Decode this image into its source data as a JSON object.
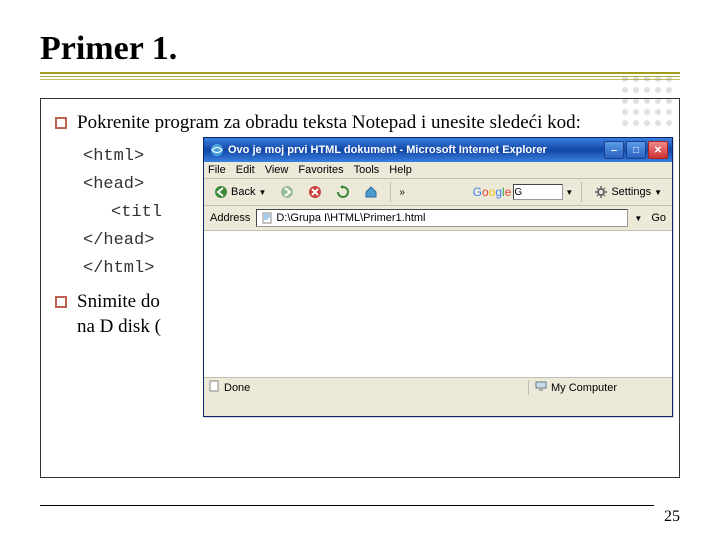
{
  "heading": "Primer 1.",
  "bullets": {
    "b1": "Pokrenite program za obradu teksta Notepad i unesite sledeći kod:",
    "b2": "Snimite do",
    "b2b": "na D disk ("
  },
  "code": {
    "l1": "<html>",
    "l2": "<head>",
    "l3": "<titl",
    "l4": "</head>",
    "l5": "</html>"
  },
  "ie": {
    "title": "Ovo je moj prvi HTML dokument - Microsoft Internet Explorer",
    "menu": {
      "file": "File",
      "edit": "Edit",
      "view": "View",
      "favorites": "Favorites",
      "tools": "Tools",
      "help": "Help"
    },
    "toolbar": {
      "back": "Back",
      "settings": "Settings",
      "sep_chevron": "»"
    },
    "google_input": "G",
    "address_label": "Address",
    "address_value": "D:\\Grupa I\\HTML\\Primer1.html",
    "go": "Go",
    "status_left": "Done",
    "status_right": "My Computer"
  },
  "page_number": "25"
}
